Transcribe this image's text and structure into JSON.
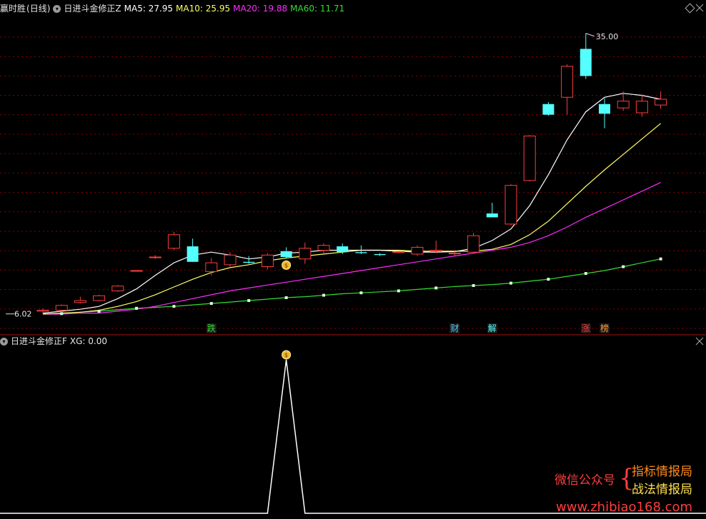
{
  "header_main": {
    "app_name": "赢时胜",
    "period": "(日线)",
    "indicator_name": "日进斗金修正Z",
    "ma5": "MA5: 27.95",
    "ma10": "MA10: 25.95",
    "ma20": "MA20: 19.88",
    "ma60": "MA60: 11.71"
  },
  "header_sub": {
    "indicator_name": "日进斗金修正F",
    "xg": "XG: 0.00"
  },
  "colors": {
    "up": "#ff3d3d",
    "down": "#54ffff",
    "ma5": "#ffffff",
    "ma10": "#ffff66",
    "ma20": "#ff2bff",
    "ma60": "#33dd33",
    "grid": "#8a0000",
    "separator": "#b01010"
  },
  "price_labels": {
    "high": "35.00",
    "low": "6.02"
  },
  "markers": [
    {
      "text": "跌",
      "color": "#33dd33"
    },
    {
      "text": "财",
      "color": "#54c8ff"
    },
    {
      "text": "解",
      "color": "#54ffff"
    },
    {
      "text": "涨",
      "color": "#ff3d3d"
    },
    {
      "text": "榜",
      "color": "#ff9a3c"
    }
  ],
  "money_bag_icon": "$",
  "watermark": {
    "label": "微信公众号",
    "line1": "指标情报局",
    "line2": "战法情报局",
    "url": "www.zhibiao168.com"
  },
  "chart_data": {
    "type": "candlestick",
    "price_range": [
      6.0,
      35.5
    ],
    "candles": [
      {
        "o": 6.3,
        "h": 6.6,
        "l": 6.02,
        "c": 6.4
      },
      {
        "o": 6.4,
        "h": 7.0,
        "l": 6.3,
        "c": 6.9
      },
      {
        "o": 7.2,
        "h": 7.8,
        "l": 7.1,
        "c": 7.4
      },
      {
        "o": 7.4,
        "h": 8.0,
        "l": 7.3,
        "c": 7.9
      },
      {
        "o": 8.4,
        "h": 9.0,
        "l": 8.3,
        "c": 8.9
      },
      {
        "o": 10.5,
        "h": 10.5,
        "l": 10.5,
        "c": 10.5
      },
      {
        "o": 11.9,
        "h": 12.1,
        "l": 11.7,
        "c": 11.9
      },
      {
        "o": 12.8,
        "h": 14.5,
        "l": 12.6,
        "c": 14.2
      },
      {
        "o": 13.0,
        "h": 13.8,
        "l": 11.4,
        "c": 11.4
      },
      {
        "o": 10.4,
        "h": 11.8,
        "l": 10.0,
        "c": 11.3
      },
      {
        "o": 11.1,
        "h": 12.4,
        "l": 10.9,
        "c": 12.1
      },
      {
        "o": 11.4,
        "h": 12.0,
        "l": 11.2,
        "c": 11.3
      },
      {
        "o": 10.9,
        "h": 12.3,
        "l": 10.6,
        "c": 12.1
      },
      {
        "o": 12.5,
        "h": 12.9,
        "l": 11.8,
        "c": 11.9
      },
      {
        "o": 11.7,
        "h": 13.4,
        "l": 11.2,
        "c": 12.8
      },
      {
        "o": 12.6,
        "h": 13.3,
        "l": 12.3,
        "c": 13.1
      },
      {
        "o": 13.0,
        "h": 13.3,
        "l": 12.2,
        "c": 12.4
      },
      {
        "o": 12.4,
        "h": 13.1,
        "l": 12.2,
        "c": 12.3
      },
      {
        "o": 12.2,
        "h": 12.3,
        "l": 12.0,
        "c": 12.1
      },
      {
        "o": 12.4,
        "h": 12.5,
        "l": 12.3,
        "c": 12.45
      },
      {
        "o": 12.2,
        "h": 13.1,
        "l": 12.0,
        "c": 12.9
      },
      {
        "o": 12.5,
        "h": 13.6,
        "l": 12.3,
        "c": 12.6
      },
      {
        "o": 12.3,
        "h": 12.5,
        "l": 12.0,
        "c": 12.3
      },
      {
        "o": 12.4,
        "h": 14.4,
        "l": 12.3,
        "c": 14.1
      },
      {
        "o": 16.4,
        "h": 17.5,
        "l": 16.0,
        "c": 16.0
      },
      {
        "o": 15.3,
        "h": 19.4,
        "l": 15.2,
        "c": 19.3
      },
      {
        "o": 19.8,
        "h": 24.5,
        "l": 19.7,
        "c": 24.4
      },
      {
        "o": 27.7,
        "h": 27.9,
        "l": 26.5,
        "c": 26.6
      },
      {
        "o": 28.4,
        "h": 31.8,
        "l": 26.6,
        "c": 31.6
      },
      {
        "o": 33.4,
        "h": 35.0,
        "l": 30.3,
        "c": 30.6
      },
      {
        "o": 27.7,
        "h": 28.3,
        "l": 25.2,
        "c": 26.7
      },
      {
        "o": 27.3,
        "h": 29.0,
        "l": 27.0,
        "c": 28.0
      },
      {
        "o": 26.8,
        "h": 28.7,
        "l": 26.4,
        "c": 28.0
      },
      {
        "o": 27.6,
        "h": 29.0,
        "l": 27.2,
        "c": 28.2
      }
    ],
    "ma5": [
      6.1,
      6.3,
      6.5,
      6.8,
      7.6,
      8.6,
      10.0,
      11.3,
      12.1,
      12.4,
      12.1,
      11.7,
      11.9,
      12.3,
      12.4,
      12.6,
      12.6,
      12.6,
      12.6,
      12.5,
      12.4,
      12.4,
      12.45,
      12.8,
      13.6,
      14.8,
      17.2,
      20.4,
      24.0,
      26.9,
      28.4,
      28.8,
      28.6,
      28.2
    ],
    "ma10": [
      6.0,
      6.1,
      6.2,
      6.4,
      6.8,
      7.3,
      8.0,
      8.8,
      9.6,
      10.3,
      10.8,
      11.1,
      11.5,
      11.8,
      12.0,
      12.2,
      12.4,
      12.6,
      12.6,
      12.6,
      12.5,
      12.5,
      12.5,
      12.5,
      12.7,
      13.2,
      14.2,
      15.6,
      17.4,
      19.2,
      20.9,
      22.5,
      24.1,
      25.7
    ],
    "ma20": [
      6.0,
      6.0,
      6.1,
      6.1,
      6.3,
      6.5,
      6.8,
      7.2,
      7.6,
      8.0,
      8.4,
      8.7,
      9.0,
      9.3,
      9.6,
      9.9,
      10.2,
      10.5,
      10.8,
      11.1,
      11.4,
      11.7,
      12.0,
      12.3,
      12.6,
      12.9,
      13.4,
      14.1,
      15.0,
      16.0,
      16.9,
      17.8,
      18.7,
      19.6
    ],
    "ma60": [
      6.0,
      6.05,
      6.2,
      6.3,
      6.45,
      6.6,
      6.7,
      6.8,
      6.95,
      7.1,
      7.25,
      7.4,
      7.55,
      7.7,
      7.8,
      7.95,
      8.1,
      8.2,
      8.3,
      8.4,
      8.55,
      8.7,
      8.85,
      8.95,
      9.05,
      9.2,
      9.4,
      9.6,
      9.9,
      10.2,
      10.5,
      10.9,
      11.3,
      11.7
    ],
    "markers_at": [
      9,
      22,
      24,
      29,
      30
    ],
    "high_index": 29,
    "low_index": 0,
    "signal_index": 13,
    "sub": {
      "series": "XG",
      "values": [
        0,
        0,
        0,
        0,
        0,
        0,
        0,
        0,
        0,
        0,
        0,
        0,
        0,
        1,
        0,
        0,
        0,
        0,
        0,
        0,
        0,
        0,
        0,
        0,
        0,
        0,
        0,
        0,
        0,
        0,
        0,
        0,
        0,
        0
      ]
    }
  }
}
